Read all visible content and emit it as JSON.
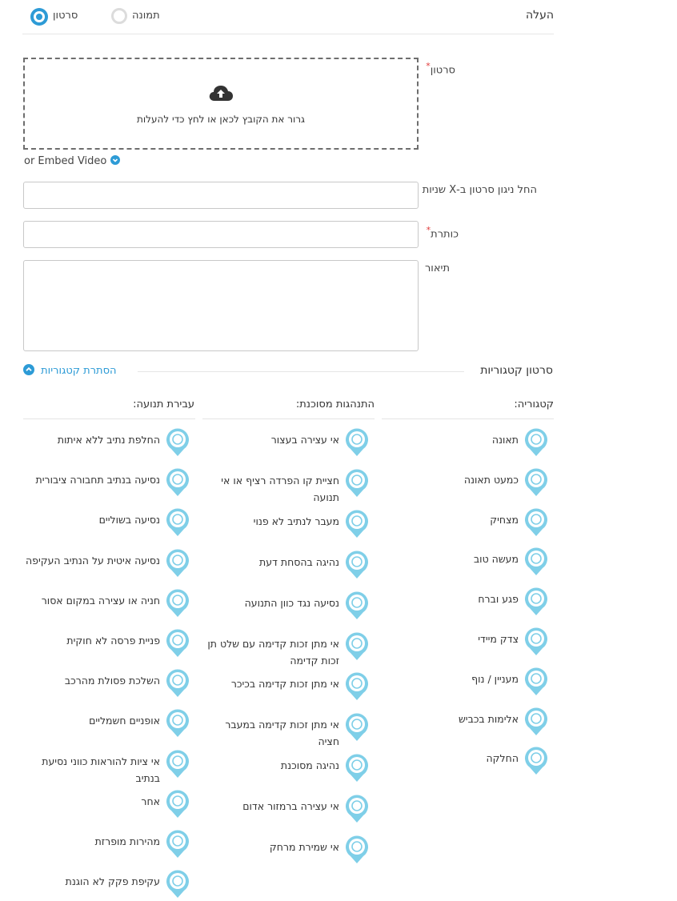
{
  "upload": {
    "section_label": "העלה",
    "option_video": "סרטון",
    "option_image": "תמונה",
    "video_label": "סרטון",
    "required_mark": "*",
    "dropzone_text": "גרור את הקובץ לכאן או לחץ כדי להעלות",
    "embed_text": "or Embed Video",
    "start_time_label": "החל ניגון סרטון ב-X שניות",
    "title_label": "כותרת",
    "description_label": "תיאור",
    "start_time_value": "",
    "title_value": "",
    "description_value": ""
  },
  "categories": {
    "section_title": "סרטון קטגוריות",
    "hide_link": "הסתרת קטגוריות",
    "columns": [
      {
        "header": "קטגוריה:",
        "items": [
          {
            "label": "תאונה",
            "icon": "crash-icon"
          },
          {
            "label": "כמעט תאונה",
            "icon": "near-miss-icon"
          },
          {
            "label": "מצחיק",
            "icon": "funny-icon"
          },
          {
            "label": "מעשה טוב",
            "icon": "good-deed-icon"
          },
          {
            "label": "פגע וברח",
            "icon": "hit-and-run-icon"
          },
          {
            "label": "צדק מיידי",
            "icon": "instant-justice-icon"
          },
          {
            "label": "מעניין / נוף",
            "icon": "scenery-icon"
          },
          {
            "label": "אלימות בכביש",
            "icon": "road-rage-icon"
          },
          {
            "label": "החלקה",
            "icon": "skid-icon"
          }
        ]
      },
      {
        "header": "התנהגות מסוכנת:",
        "items": [
          {
            "label": "אי עצירה בעצור",
            "icon": "stop-sign-icon"
          },
          {
            "label": "חציית קו הפרדה רציף או אי תנועה",
            "icon": "solid-line-icon"
          },
          {
            "label": "מעבר לנתיב לא פנוי",
            "icon": "lane-change-icon"
          },
          {
            "label": "נהיגה בהסחת דעת",
            "icon": "distracted-driving-icon"
          },
          {
            "label": "נסיעה נגד כוון התנועה",
            "icon": "wrong-way-icon"
          },
          {
            "label": "אי מתן זכות קדימה עם שלט תן זכות קדימה",
            "icon": "yield-sign-icon"
          },
          {
            "label": "אי מתן זכות קדימה בכיכר",
            "icon": "roundabout-icon"
          },
          {
            "label": "אי מתן זכות קדימה במעבר חציה",
            "icon": "crosswalk-icon"
          },
          {
            "label": "נהיגה מסוכנת",
            "icon": "dangerous-driving-icon"
          },
          {
            "label": "אי עצירה ברמזור אדום",
            "icon": "traffic-light-icon"
          },
          {
            "label": "אי שמירת מרחק",
            "icon": "tailgating-icon"
          }
        ]
      },
      {
        "header": "עבירת תנועה:",
        "items": [
          {
            "label": "החלפת נתיב ללא איתות",
            "icon": "no-signal-lane-change-icon"
          },
          {
            "label": "נסיעה בנתיב תחבורה ציבורית",
            "icon": "bus-lane-icon"
          },
          {
            "label": "נסיעה בשוליים",
            "icon": "shoulder-driving-icon"
          },
          {
            "label": "נסיעה איטית על הנתיב העקיפה",
            "icon": "slow-overtake-lane-icon"
          },
          {
            "label": "חניה או עצירה במקום אסור",
            "icon": "no-parking-icon"
          },
          {
            "label": "פניית פרסה לא חוקית",
            "icon": "u-turn-icon"
          },
          {
            "label": "השלכת פסולת מהרכב",
            "icon": "littering-icon"
          },
          {
            "label": "אופניים חשמליים",
            "icon": "e-bike-icon"
          },
          {
            "label": "אי ציות להוראות כווני נסיעת בנתיב",
            "icon": "no-entry-icon"
          },
          {
            "label": "אחר",
            "icon": "other-icon"
          },
          {
            "label": "מהירות מופרזת",
            "icon": "speeding-icon"
          },
          {
            "label": "עקיפת פקק לא הוגנת",
            "icon": "unfair-overtake-icon"
          }
        ]
      }
    ]
  },
  "colors": {
    "accent": "#2d9bd6",
    "pin": "#7fcfe8",
    "border": "#c8c8c8"
  }
}
